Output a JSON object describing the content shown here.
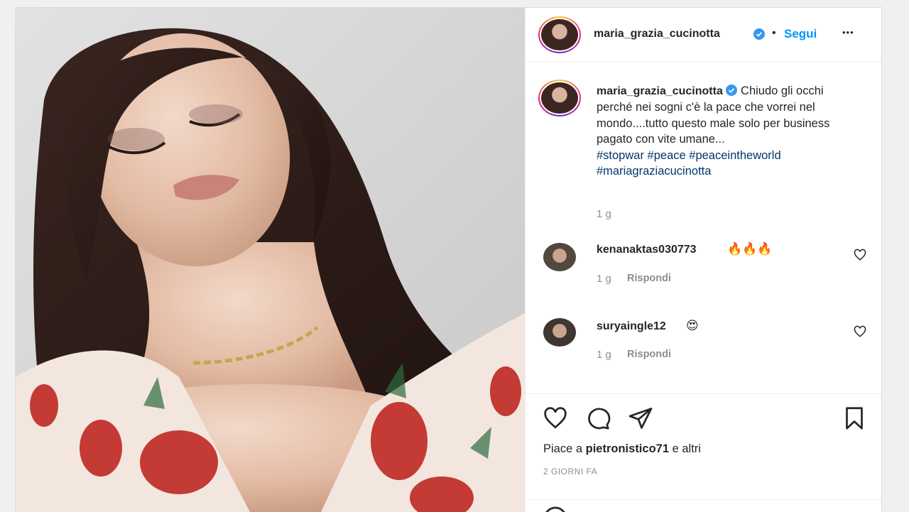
{
  "post": {
    "author": "maria_grazia_cucinotta",
    "separator": "•",
    "follow_label": "Segui",
    "more_label": "•••"
  },
  "caption": {
    "author": "maria_grazia_cucinotta",
    "text": "Chiudo gli occhi perché nei sogni c'è la pace che vorrei nel mondo....tutto questo male solo per business pagato con vite umane...",
    "hashtags": [
      "#stopwar",
      "#peace",
      "#peaceintheworld",
      "#mariagraziacucinotta"
    ],
    "age": "1 g"
  },
  "comments": [
    {
      "user": "kenanaktas030773",
      "text": "🔥🔥🔥",
      "age": "1 g",
      "reply_label": "Rispondi"
    },
    {
      "user": "suryaingle12",
      "text": "😍",
      "age": "1 g",
      "reply_label": "Rispondi"
    }
  ],
  "footer": {
    "likes_prefix": "Piace a",
    "likes_user": "pietronistico71",
    "likes_suffix": "e altri",
    "date": "2 GIORNI FA"
  },
  "icons": {
    "like": "heart-icon",
    "comment": "comment-icon",
    "share": "send-icon",
    "save": "bookmark-icon",
    "verified": "verified-badge-icon"
  },
  "colors": {
    "accent": "#0095f6",
    "hashtag": "#00376b",
    "muted": "#8e8e8e",
    "verified": "#3897f0"
  }
}
